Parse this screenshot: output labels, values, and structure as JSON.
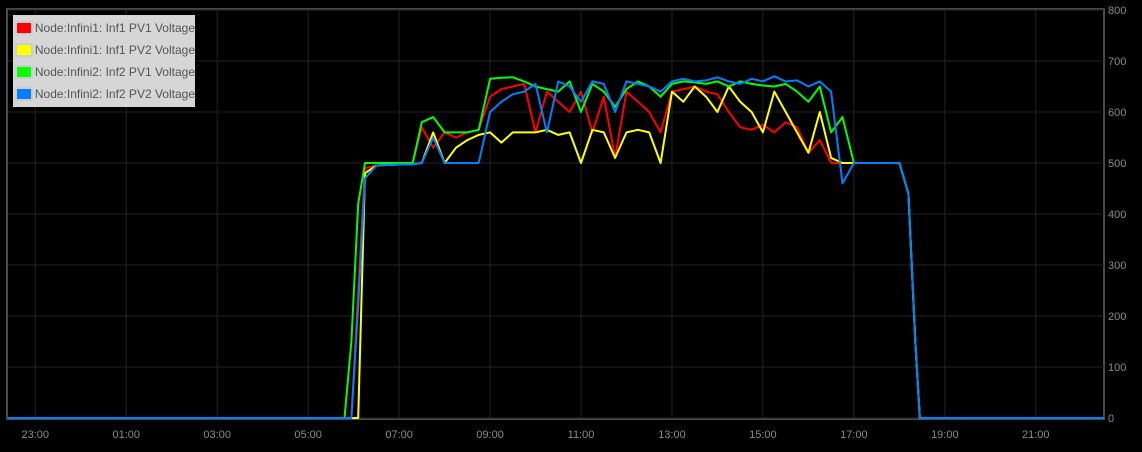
{
  "chart_data": {
    "type": "line",
    "title": "",
    "xlabel": "",
    "ylabel": "",
    "x_unit": "hour of day (negative = previous day)",
    "xlim": [
      -1.6,
      22.5
    ],
    "ylim": [
      0,
      800
    ],
    "grid": true,
    "legend_position": "top-left",
    "x_ticks": [
      {
        "value": -1,
        "label": "23:00"
      },
      {
        "value": 1,
        "label": "01:00"
      },
      {
        "value": 3,
        "label": "03:00"
      },
      {
        "value": 5,
        "label": "05:00"
      },
      {
        "value": 7,
        "label": "07:00"
      },
      {
        "value": 9,
        "label": "09:00"
      },
      {
        "value": 11,
        "label": "11:00"
      },
      {
        "value": 13,
        "label": "13:00"
      },
      {
        "value": 15,
        "label": "15:00"
      },
      {
        "value": 17,
        "label": "17:00"
      },
      {
        "value": 19,
        "label": "19:00"
      },
      {
        "value": 21,
        "label": "21:00"
      }
    ],
    "y_ticks": [
      "0",
      "100",
      "200",
      "300",
      "400",
      "500",
      "600",
      "700",
      "800"
    ],
    "x": [
      -1.6,
      5.8,
      5.95,
      6.1,
      6.25,
      6.5,
      7,
      7.3,
      7.5,
      7.75,
      8,
      8.25,
      8.5,
      8.75,
      9,
      9.25,
      9.5,
      9.75,
      10,
      10.25,
      10.5,
      10.75,
      11,
      11.25,
      11.5,
      11.75,
      12,
      12.25,
      12.5,
      12.75,
      13,
      13.25,
      13.5,
      13.75,
      14,
      14.25,
      14.5,
      14.75,
      15,
      15.25,
      15.5,
      15.75,
      16,
      16.25,
      16.5,
      16.75,
      17,
      17.5,
      18,
      18.2,
      18.35,
      18.45,
      22.5
    ],
    "series": [
      {
        "name": "Node:Infini1: Inf1 PV1 Voltage",
        "color": "#ff0000",
        "values": [
          0,
          0,
          0,
          250,
          490,
          495,
          497,
          500,
          570,
          530,
          560,
          550,
          560,
          565,
          630,
          645,
          650,
          655,
          560,
          640,
          620,
          600,
          640,
          560,
          630,
          510,
          640,
          620,
          600,
          560,
          640,
          645,
          650,
          640,
          635,
          600,
          570,
          565,
          575,
          560,
          580,
          570,
          520,
          545,
          500,
          500,
          500,
          500,
          500,
          440,
          150,
          0,
          0
        ]
      },
      {
        "name": "Node:Infini1: Inf1 PV2 Voltage",
        "color": "#ffff00",
        "values": [
          0,
          0,
          0,
          0,
          480,
          495,
          497,
          498,
          500,
          560,
          500,
          530,
          545,
          555,
          560,
          540,
          560,
          560,
          560,
          565,
          555,
          560,
          500,
          565,
          560,
          510,
          560,
          565,
          560,
          500,
          640,
          620,
          650,
          630,
          600,
          650,
          620,
          600,
          560,
          640,
          600,
          560,
          520,
          600,
          510,
          500,
          500,
          500,
          500,
          440,
          150,
          0,
          0
        ]
      },
      {
        "name": "Node:Infini2: Inf2 PV1 Voltage",
        "color": "#00ff00",
        "values": [
          0,
          0,
          150,
          420,
          500,
          500,
          500,
          500,
          580,
          590,
          560,
          560,
          560,
          565,
          665,
          667,
          668,
          660,
          650,
          645,
          640,
          660,
          600,
          655,
          640,
          610,
          645,
          660,
          650,
          630,
          655,
          660,
          658,
          655,
          660,
          650,
          660,
          655,
          652,
          650,
          655,
          640,
          620,
          650,
          560,
          590,
          500,
          500,
          500,
          440,
          150,
          0,
          0
        ]
      },
      {
        "name": "Node:Infini2: Inf2 PV2 Voltage",
        "color": "#0080ff",
        "values": [
          0,
          0,
          0,
          220,
          470,
          495,
          497,
          497,
          500,
          550,
          500,
          500,
          500,
          500,
          600,
          620,
          635,
          640,
          655,
          560,
          660,
          650,
          620,
          660,
          655,
          600,
          660,
          655,
          650,
          640,
          660,
          665,
          660,
          662,
          668,
          660,
          655,
          665,
          660,
          670,
          660,
          662,
          650,
          660,
          640,
          460,
          500,
          500,
          500,
          440,
          150,
          0,
          0
        ]
      }
    ]
  }
}
